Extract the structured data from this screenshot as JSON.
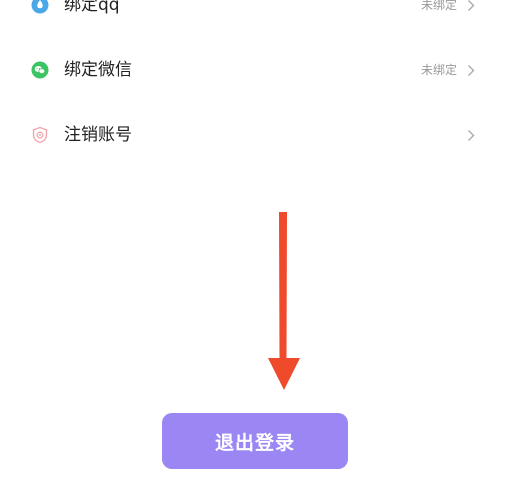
{
  "settings_list": {
    "items": [
      {
        "label": "绑定qq",
        "status": "未绑定",
        "icon": "qq-icon"
      },
      {
        "label": "绑定微信",
        "status": "未绑定",
        "icon": "wechat-icon"
      },
      {
        "label": "注销账号",
        "status": "",
        "icon": "cancel-account-icon"
      }
    ]
  },
  "logout": {
    "label": "退出登录"
  },
  "annotation": {
    "icon": "arrow-down-icon",
    "color": "#f04a2c"
  },
  "colors": {
    "qq_icon": "#4aa8e8",
    "wechat_icon": "#3cc464",
    "cancel_icon": "#f0a8b0",
    "button_bg": "#9b86f4"
  }
}
